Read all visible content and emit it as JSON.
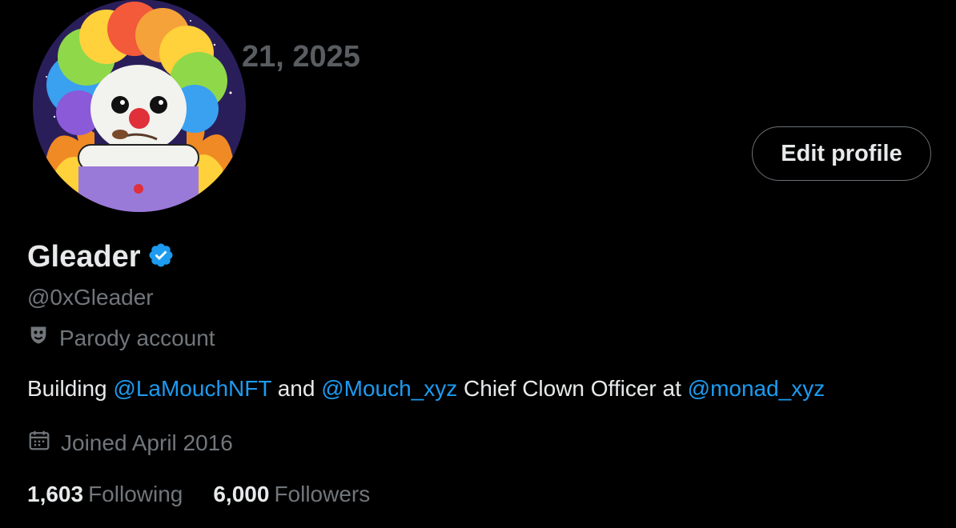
{
  "banner": {
    "date_text": "21, 2025"
  },
  "profile": {
    "edit_label": "Edit profile",
    "display_name": "Gleader",
    "handle": "@0xGleader",
    "parody_label": "Parody account",
    "bio": {
      "t1": "Building ",
      "m1": "@LaMouchNFT",
      "t2": " and ",
      "m2": "@Mouch_xyz",
      "t3": " Chief Clown Officer at ",
      "m3": "@monad_xyz"
    },
    "joined": "Joined April 2016",
    "following_count": "1,603",
    "following_label": "Following",
    "followers_count": "6,000",
    "followers_label": "Followers"
  },
  "icons": {
    "verified": "verified-badge-icon",
    "parody": "theater-mask-icon",
    "calendar": "calendar-icon"
  },
  "colors": {
    "link": "#1d9bf0",
    "muted": "#71767b",
    "text": "#e7e9ea",
    "background": "#000000"
  }
}
